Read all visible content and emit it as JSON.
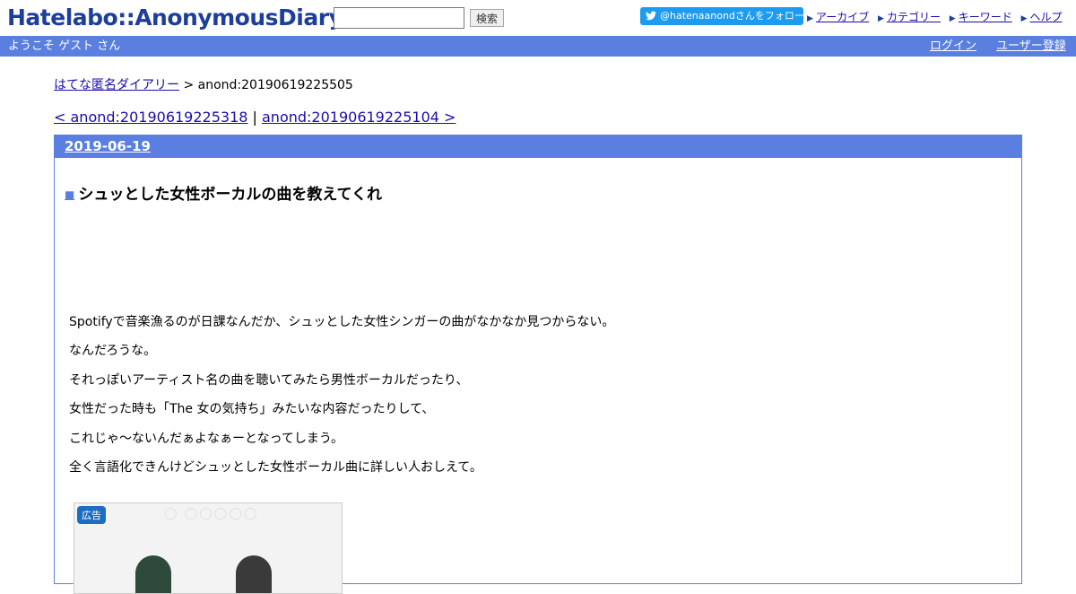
{
  "header": {
    "logo": "Hatelabo::AnonymousDiary",
    "search_placeholder": "",
    "search_label": "検索",
    "follow_label": "@hatenaanondさんをフォロー",
    "links": [
      "アーカイブ",
      "カテゴリー",
      "キーワード",
      "ヘルプ"
    ]
  },
  "bar": {
    "welcome": "ようこそ ゲスト さん",
    "login": "ログイン",
    "signup": "ユーザー登録"
  },
  "breadcrumb": {
    "home": "はてな匿名ダイアリー",
    "sep": " > ",
    "current": "anond:20190619225505"
  },
  "pager": {
    "prev": "< anond:20190619225318",
    "sep": " | ",
    "next": "anond:20190619225104 >"
  },
  "entry": {
    "date": "2019-06-19",
    "title": "シュッとした女性ボーカルの曲を教えてくれ",
    "lines": [
      "Spotifyで音楽漁るのが日課なんだか、シュッとした女性シンガーの曲がなかなか見つからない。",
      "なんだろうな。",
      "それっぽいアーティスト名の曲を聴いてみたら男性ボーカルだったり、",
      "女性だった時も「The 女の気持ち」みたいな内容だったりして、",
      "これじゃ〜ないんだぁよなぁーとなってしまう。",
      "全く言語化できんけどシュッとした女性ボーカル曲に詳しい人おしえて。"
    ],
    "ad_label": "広告"
  },
  "colors": {
    "accent": "#5a7fe0",
    "logo": "#1d3f9a",
    "twitter": "#1d9bf0"
  }
}
